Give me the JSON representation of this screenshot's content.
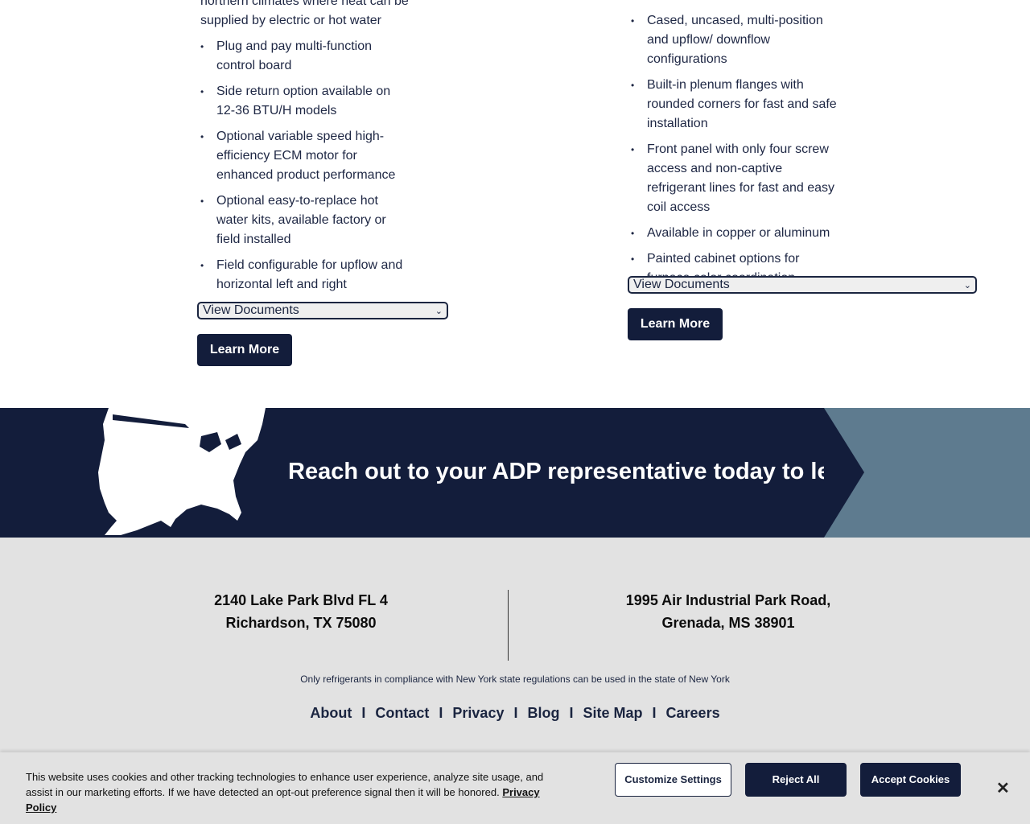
{
  "products": {
    "left": {
      "bullets": [
        "northern climates where heat can be supplied by electric or hot water",
        "Plug and pay multi-function control board",
        "Side return option available on 12-36 BTU/H models",
        "Optional variable speed high-efficiency ECM motor for enhanced product performance",
        "Optional easy-to-replace hot water kits, available factory or field installed",
        "Field configurable for upflow and horizontal left and right"
      ],
      "documents_select": "View Documents",
      "learn_more": "Learn More"
    },
    "right": {
      "bullets": [
        "Cased, uncased, multi-position and upflow/ downflow configurations",
        "Built-in plenum flanges with rounded corners for fast and safe installation",
        "Front panel with only four screw access and non-captive refrigerant lines for fast and easy coil access",
        "Available in copper or aluminum",
        "Painted cabinet options for furnace color coordination"
      ],
      "documents_select": "View Documents",
      "learn_more": "Learn More"
    }
  },
  "banner": {
    "text": "Reach out to your ADP representative today to lea",
    "colors": {
      "navy": "#131d3b",
      "slate": "#5e7b8f"
    }
  },
  "footer": {
    "address_left": {
      "line1": "2140 Lake Park Blvd FL 4",
      "line2": "Richardson, TX 75080"
    },
    "address_right": {
      "line1": "1995 Air Industrial Park Road,",
      "line2": "Grenada, MS 38901"
    },
    "notice": "Only refrigerants in compliance with New York state regulations can be used in the state of New York",
    "nav": [
      "About",
      "Contact",
      "Privacy",
      "Blog",
      "Site Map",
      "Careers"
    ],
    "separator": "I"
  },
  "cookie_banner": {
    "text": "This website uses cookies and other tracking technologies to enhance user experience, analyze site usage, and assist in our marketing efforts. If we have detected an opt-out preference signal then it will be honored.",
    "policy_link": "Privacy Policy",
    "customize": "Customize Settings",
    "reject": "Reject All",
    "accept": "Accept Cookies",
    "close_icon": "close-icon"
  }
}
